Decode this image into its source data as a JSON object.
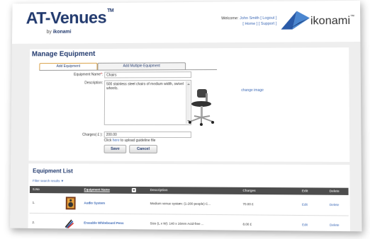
{
  "brand": {
    "title": "AT-Venues",
    "trademark": "TM",
    "by": "by",
    "company": "ikonami"
  },
  "header": {
    "welcome_prefix": "Welcome:",
    "user_name": "John Smith",
    "logout": "[ Logout ]",
    "home": "[ Home ]",
    "support": "[ Support ]"
  },
  "logo": {
    "text": "ikonami",
    "tm": "™"
  },
  "page": {
    "title": "Manage Equipment"
  },
  "tabs": [
    {
      "label": "Add Equipment"
    },
    {
      "label": "Add Multiple Equipment"
    }
  ],
  "form": {
    "name_label": "Equipment Name",
    "required": "*",
    "name_value": "Chairs",
    "description_label": "Description",
    "description_value": "500 stainless steel chairs of medium width, swivel wheels.",
    "charges_label": "Charges( £ ):",
    "charges_value": "200.00",
    "change_image": "change image",
    "upload_prefix": "Click ",
    "upload_link": "here",
    "upload_suffix": " to upload guideline file",
    "save": "Save",
    "cancel": "Cancel"
  },
  "list": {
    "title": "Equipment List",
    "filter": "Filter search results ▼",
    "columns": {
      "sno": "S.No",
      "name": "Equipment Name",
      "description": "Description",
      "charges": "Charges",
      "edit": "Edit",
      "delete": "Delete"
    },
    "rows": [
      {
        "sno": "1.",
        "name": "Audio System",
        "description": "Medium venue system: (1-200 people) C...",
        "charges": "70.00 £",
        "edit": "Edit",
        "delete": "Delete"
      },
      {
        "sno": "2.",
        "name": "Erasable Whiteboard Pens",
        "description": "Size (L x W): 140 x 16mm Acid-free ...",
        "charges": "8.00 £",
        "edit": "Edit",
        "delete": "Delete"
      }
    ]
  },
  "colors": {
    "brand_navy": "#223a6e",
    "link_blue": "#3a67b5",
    "tab_orange": "#d8a046",
    "header_grey": "#4d4d4d"
  }
}
